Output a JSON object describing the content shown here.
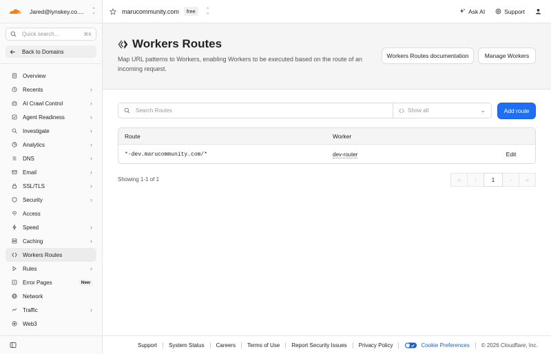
{
  "account": {
    "name": "Jared@lynskey.co...."
  },
  "sidebar": {
    "search_placeholder": "Quick search...",
    "search_shortcut": "⌘K",
    "back_label": "Back to Domains",
    "items": [
      {
        "label": "Overview",
        "icon": "document-icon",
        "chevron": false
      },
      {
        "label": "Recents",
        "icon": "clock-icon",
        "chevron": true
      },
      {
        "label": "AI Crawl Control",
        "icon": "robot-icon",
        "chevron": true
      },
      {
        "label": "Agent Readiness",
        "icon": "agent-icon",
        "chevron": true
      },
      {
        "label": "Investigate",
        "icon": "search-icon",
        "chevron": true
      },
      {
        "label": "Analytics",
        "icon": "chart-icon",
        "chevron": true
      },
      {
        "label": "DNS",
        "icon": "dns-icon",
        "chevron": true
      },
      {
        "label": "Email",
        "icon": "mail-icon",
        "chevron": true
      },
      {
        "label": "SSL/TLS",
        "icon": "lock-icon",
        "chevron": true
      },
      {
        "label": "Security",
        "icon": "shield-icon",
        "chevron": true
      },
      {
        "label": "Access",
        "icon": "access-icon",
        "chevron": false
      },
      {
        "label": "Speed",
        "icon": "bolt-icon",
        "chevron": true
      },
      {
        "label": "Caching",
        "icon": "caching-icon",
        "chevron": true
      },
      {
        "label": "Workers Routes",
        "icon": "workers-icon",
        "chevron": false,
        "active": true
      },
      {
        "label": "Rules",
        "icon": "rules-icon",
        "chevron": true
      },
      {
        "label": "Error Pages",
        "icon": "error-page-icon",
        "chevron": false,
        "badge": "New"
      },
      {
        "label": "Network",
        "icon": "network-icon",
        "chevron": false
      },
      {
        "label": "Traffic",
        "icon": "traffic-icon",
        "chevron": true
      },
      {
        "label": "Web3",
        "icon": "web3-icon",
        "chevron": false
      }
    ]
  },
  "topbar": {
    "domain": "marucommunity.com",
    "plan": "free",
    "ask_ai": "Ask AI",
    "support": "Support"
  },
  "header": {
    "title": "Workers Routes",
    "description": "Map URL patterns to Workers, enabling Workers to be executed based on the route of an incoming request.",
    "docs_button": "Workers Routes documentation",
    "manage_button": "Manage Workers"
  },
  "toolbar": {
    "search_placeholder": "Search Routes",
    "filter_value": "Show all",
    "add_button": "Add route"
  },
  "table": {
    "columns": [
      "Route",
      "Worker"
    ],
    "rows": [
      {
        "route": "*-dev.marucommunity.com/*",
        "worker": "dev-router",
        "action": "Edit"
      }
    ]
  },
  "pagination": {
    "showing": "Showing 1-1 of 1",
    "current_page": "1"
  },
  "footer": {
    "links": [
      "Support",
      "System Status",
      "Careers",
      "Terms of Use",
      "Report Security Issues",
      "Privacy Policy"
    ],
    "cookie_label": "Cookie Preferences",
    "copyright": "© 2026 Cloudflare, Inc."
  },
  "colors": {
    "accent": "#1f6ff5",
    "brand_orange": "#f48120",
    "link": "#1f5fc7"
  }
}
